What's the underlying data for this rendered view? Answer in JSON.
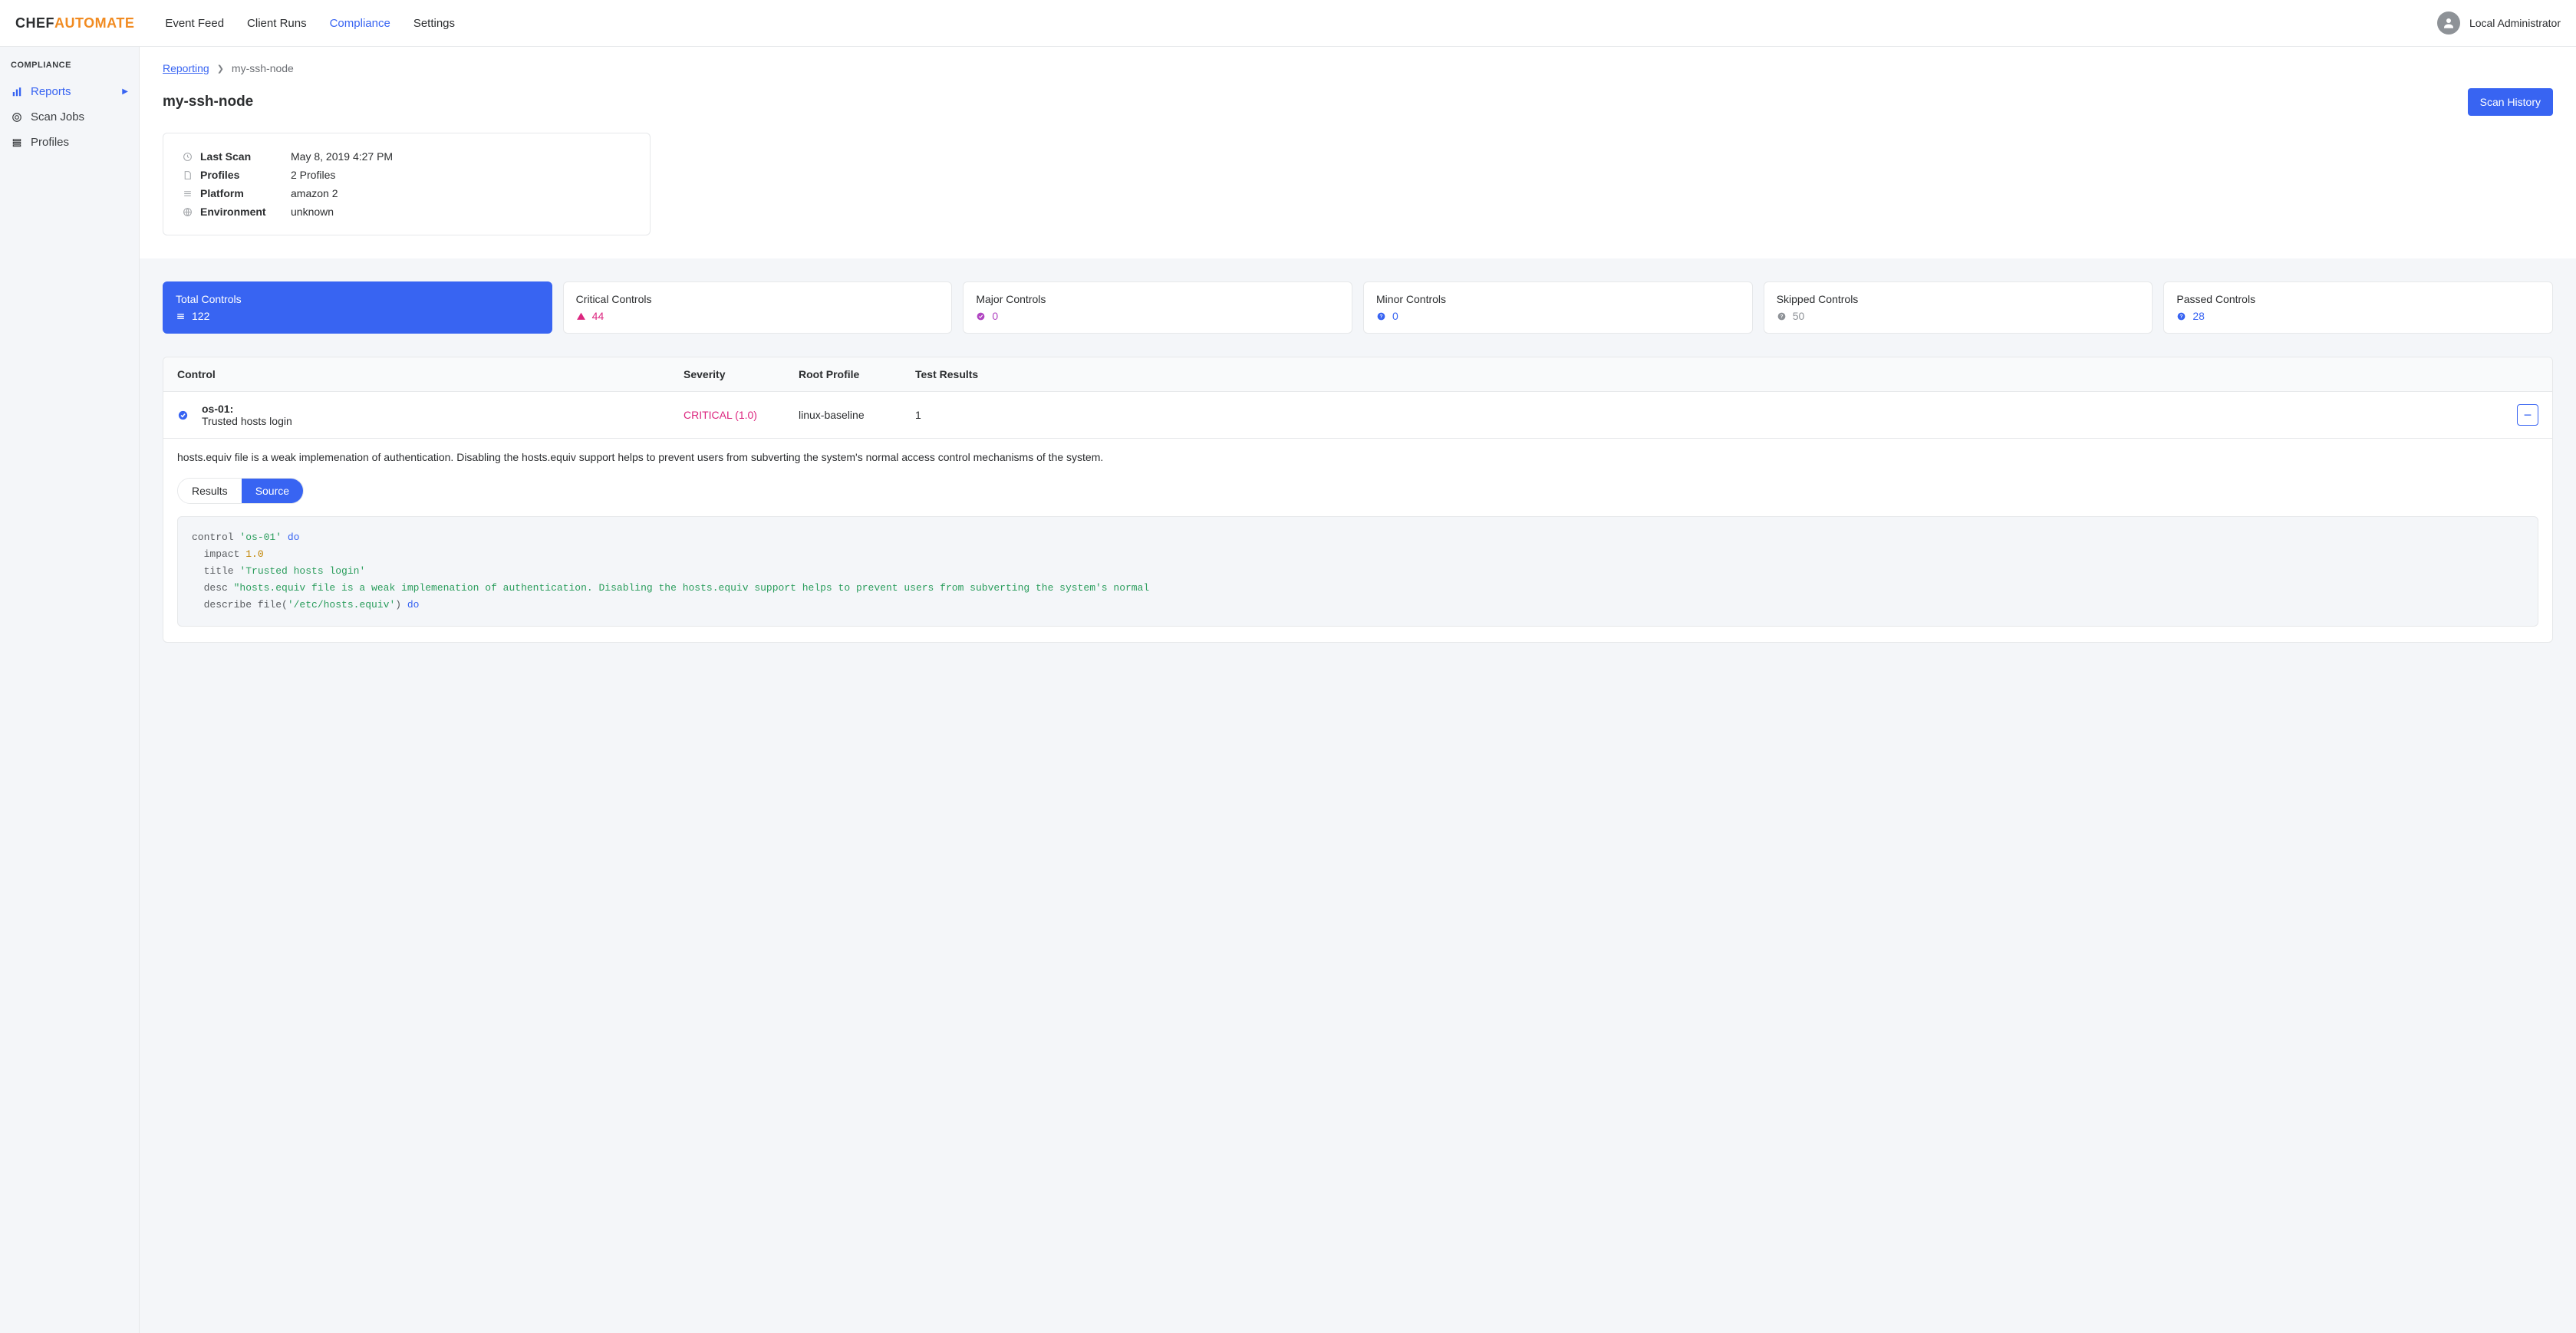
{
  "logo": {
    "part1": "CHEF",
    "part2": "AUTOMATE"
  },
  "nav": {
    "items": [
      "Event Feed",
      "Client Runs",
      "Compliance",
      "Settings"
    ],
    "active_index": 2
  },
  "user": {
    "label": "Local Administrator"
  },
  "sidebar": {
    "title": "COMPLIANCE",
    "items": [
      {
        "label": "Reports",
        "icon": "bar-chart",
        "active": true,
        "has_arrow": true
      },
      {
        "label": "Scan Jobs",
        "icon": "target",
        "active": false,
        "has_arrow": false
      },
      {
        "label": "Profiles",
        "icon": "layers",
        "active": false,
        "has_arrow": false
      }
    ]
  },
  "breadcrumb": {
    "link": "Reporting",
    "current": "my-ssh-node"
  },
  "page_title": "my-ssh-node",
  "scan_history_label": "Scan History",
  "summary": {
    "rows": [
      {
        "icon": "clock",
        "label": "Last Scan",
        "value": "May 8, 2019 4:27 PM"
      },
      {
        "icon": "file",
        "label": "Profiles",
        "value": "2 Profiles"
      },
      {
        "icon": "list",
        "label": "Platform",
        "value": "amazon 2"
      },
      {
        "icon": "globe",
        "label": "Environment",
        "value": "unknown"
      }
    ]
  },
  "tiles": [
    {
      "title": "Total Controls",
      "icon": "list",
      "count": "122",
      "color": "active"
    },
    {
      "title": "Critical Controls",
      "icon": "alert-triangle",
      "count": "44",
      "color": "red"
    },
    {
      "title": "Major Controls",
      "icon": "check-circle",
      "count": "0",
      "color": "purple"
    },
    {
      "title": "Minor Controls",
      "icon": "help-circle",
      "count": "0",
      "color": "blue"
    },
    {
      "title": "Skipped Controls",
      "icon": "help-circle",
      "count": "50",
      "color": "gray"
    },
    {
      "title": "Passed Controls",
      "icon": "help-circle",
      "count": "28",
      "color": "blue"
    }
  ],
  "table": {
    "headers": {
      "control": "Control",
      "severity": "Severity",
      "root": "Root Profile",
      "tests": "Test Results"
    },
    "rows": [
      {
        "id": "os-01:",
        "title": "Trusted hosts login",
        "severity": "CRITICAL (1.0)",
        "root": "linux-baseline",
        "tests": "1"
      }
    ]
  },
  "expanded": {
    "description": "hosts.equiv file is a weak implemenation of authentication. Disabling the hosts.equiv support helps to prevent users from subverting the system's normal access control mechanisms of the system.",
    "tabs": {
      "results": "Results",
      "source": "Source",
      "active": "source"
    },
    "source_lines": [
      {
        "t": "plain",
        "v": "control "
      },
      {
        "t": "str",
        "v": "'os-01'"
      },
      {
        "t": "plain",
        "v": " "
      },
      {
        "t": "kw",
        "v": "do"
      },
      {
        "t": "nl"
      },
      {
        "t": "plain",
        "v": "  impact "
      },
      {
        "t": "num",
        "v": "1.0"
      },
      {
        "t": "nl"
      },
      {
        "t": "plain",
        "v": "  title "
      },
      {
        "t": "str",
        "v": "'Trusted hosts login'"
      },
      {
        "t": "nl"
      },
      {
        "t": "plain",
        "v": "  desc "
      },
      {
        "t": "str",
        "v": "\"hosts.equiv file is a weak implemenation of authentication. Disabling the hosts.equiv support helps to prevent users from subverting the system's normal"
      },
      {
        "t": "nl"
      },
      {
        "t": "plain",
        "v": "  describe file("
      },
      {
        "t": "str",
        "v": "'/etc/hosts.equiv'"
      },
      {
        "t": "plain",
        "v": ") "
      },
      {
        "t": "kw",
        "v": "do"
      }
    ]
  }
}
